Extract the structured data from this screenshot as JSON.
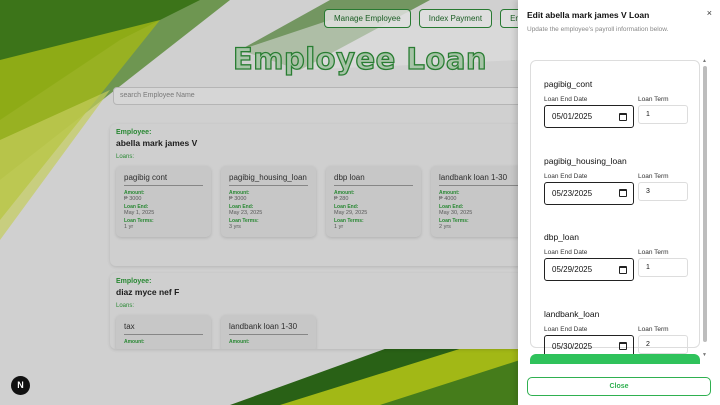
{
  "background": {
    "nav": [
      "Manage Employee",
      "Index Payment",
      "Empl"
    ],
    "title": "Employee Loan",
    "search_placeholder": "search Employee Name",
    "employees": [
      {
        "label": "Employee:",
        "name": "abella mark james V",
        "loans_label": "Loans:",
        "loans": [
          {
            "name": "pagibig cont",
            "amount_label": "Amount:",
            "amount": "₱ 3000",
            "end_label": "Loan End:",
            "end": "May 1, 2025",
            "term_label": "Loan Terms:",
            "term": "1 yr"
          },
          {
            "name": "pagibig_housing_loan",
            "amount_label": "Amount:",
            "amount": "₱ 3000",
            "end_label": "Loan End:",
            "end": "May 23, 2025",
            "term_label": "Loan Terms:",
            "term": "3 yrs"
          },
          {
            "name": "dbp loan",
            "amount_label": "Amount:",
            "amount": "₱ 280",
            "end_label": "Loan End:",
            "end": "May 29, 2025",
            "term_label": "Loan Terms:",
            "term": "1 yr"
          },
          {
            "name": "landbank loan 1-30",
            "amount_label": "Amount:",
            "amount": "₱ 4000",
            "end_label": "Loan End:",
            "end": "May 30, 2025",
            "term_label": "Loan Terms:",
            "term": "2 yrs"
          }
        ]
      },
      {
        "label": "Employee:",
        "name": "diaz myce nef F",
        "loans_label": "Loans:",
        "loans": [
          {
            "name": "tax",
            "amount_label": "Amount:"
          },
          {
            "name": "landbank loan 1-30",
            "amount_label": "Amount:"
          }
        ]
      }
    ]
  },
  "badge": "N",
  "panel": {
    "title": "Edit abella mark james V Loan",
    "subtitle": "Update the employee's payroll information below.",
    "close_x": "×",
    "end_date_label": "Loan End Date",
    "term_label": "Loan Term",
    "loans": [
      {
        "name": "pagibig_cont",
        "end_date": "05/01/2025",
        "term": "1"
      },
      {
        "name": "pagibig_housing_loan",
        "end_date": "05/23/2025",
        "term": "3"
      },
      {
        "name": "dbp_loan",
        "end_date": "05/29/2025",
        "term": "1"
      },
      {
        "name": "landbank_loan",
        "end_date": "05/30/2025",
        "term": "2"
      }
    ],
    "close_label": "Close"
  },
  "colors": {
    "accent": "#2fc25b",
    "brand_green": "#2e9b3a"
  }
}
